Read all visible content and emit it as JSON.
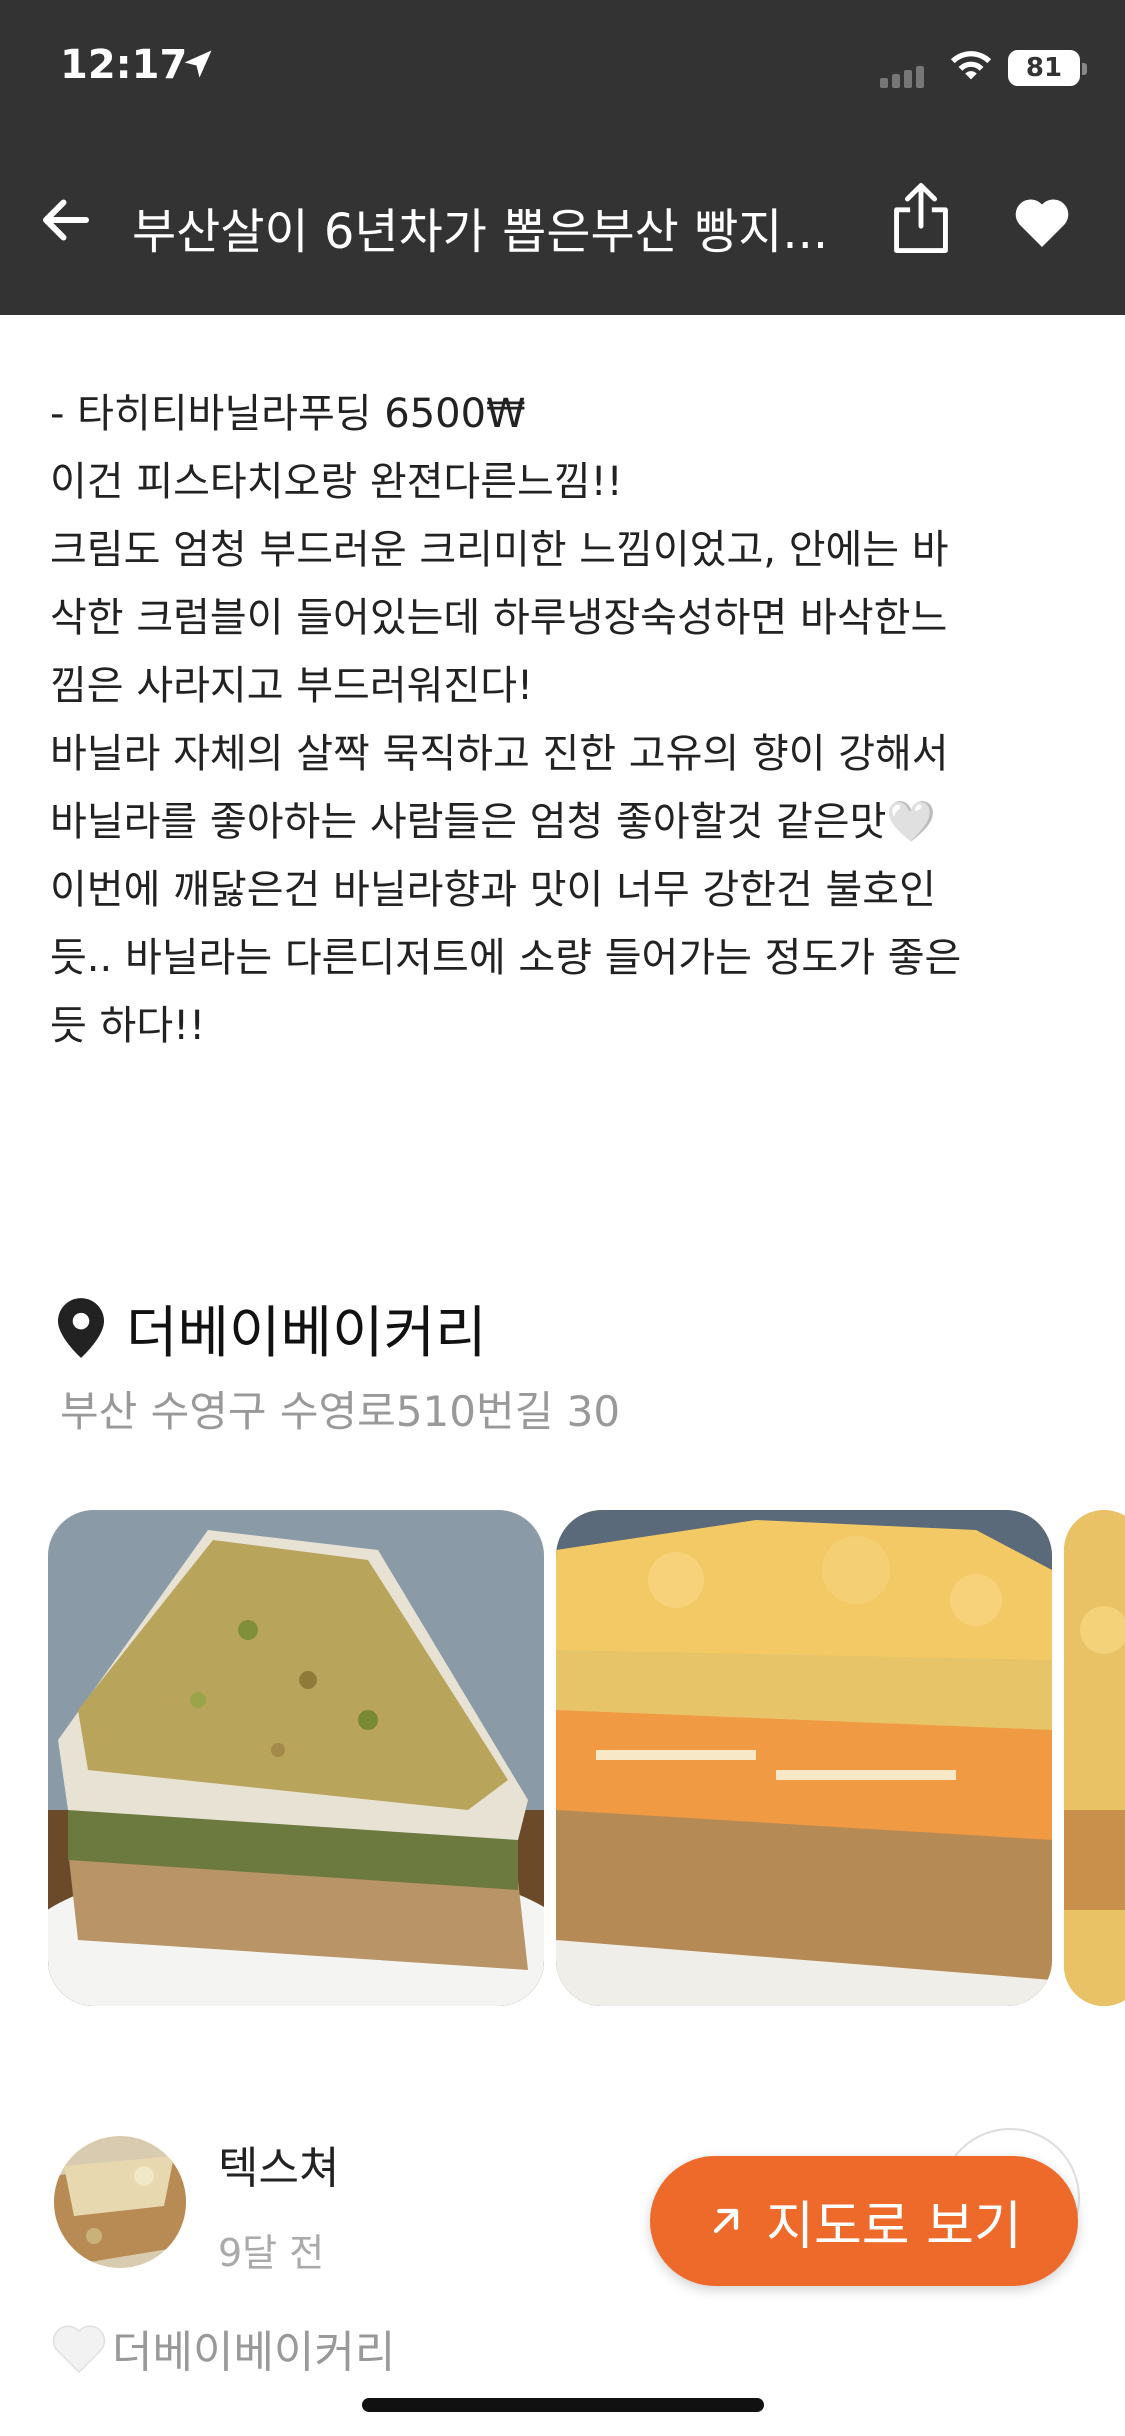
{
  "status_bar": {
    "time": "12:17",
    "battery": "81"
  },
  "nav": {
    "title": "부산살이 6년차가 뽑은부산 빵지..."
  },
  "content": {
    "lines": [
      "- 타히티바닐라푸딩 6500₩",
      "이건 피스타치오랑 완젼다른느낌!!",
      "크림도 엄청 부드러운 크리미한 느낌이었고, 안에는 바",
      "삭한 크럼블이 들어있는데 하루냉장숙성하면 바삭한느",
      "낌은 사라지고 부드러워진다!",
      "바닐라 자체의 살짝 묵직하고 진한 고유의 향이 강해서",
      "바닐라를 좋아하는 사람들은 엄청 좋아할것 같은맛🤍",
      "이번에 깨닳은건 바닐라향과 맛이 너무 강한건 불호인",
      "듯.. 바닐라는 다른디저트에 소량 들어가는 정도가 좋은",
      "듯 하다!!"
    ]
  },
  "place": {
    "name": "더베이베이커리",
    "address": "부산 수영구 수영로510번길 30"
  },
  "comment": {
    "author": "텍스쳐",
    "time": "9달 전"
  },
  "map_button": {
    "label": "지도로 보기"
  },
  "footer": {
    "tag": "더베이베이커리"
  },
  "colors": {
    "header_bg": "#333333",
    "accent": "#ee6a2b",
    "muted_text": "#999999"
  }
}
